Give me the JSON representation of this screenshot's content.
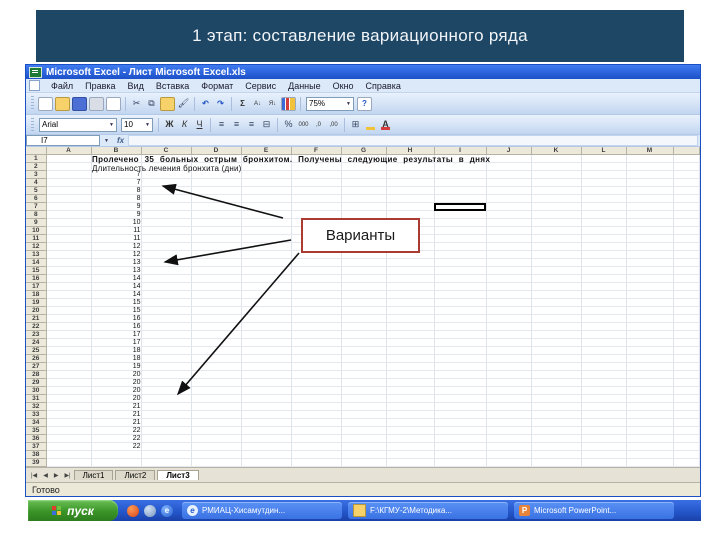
{
  "slide": {
    "title": "1 этап: составление вариационного  ряда"
  },
  "excel": {
    "window_title": "Microsoft Excel - Лист Microsoft Excel.xls",
    "menu_items": [
      "Файл",
      "Правка",
      "Вид",
      "Вставка",
      "Формат",
      "Сервис",
      "Данные",
      "Окно",
      "Справка"
    ],
    "zoom_level": "75%",
    "font_name": "Arial",
    "font_size": "10",
    "format_buttons": [
      "Ж",
      "К",
      "Ч"
    ],
    "name_box": "I7",
    "fx_label": "fx",
    "columns": [
      "A",
      "B",
      "C",
      "D",
      "E",
      "F",
      "G",
      "H",
      "I",
      "J",
      "K",
      "L",
      "M"
    ],
    "selected_column": "I",
    "selected_row": 7,
    "row1_text": "Пролечено 35 больных острым бронхитом. Получены следующие результаты в днях",
    "row2_text": "Длительность лечения бронхита (дни)",
    "values_start_row": 3,
    "values": [
      7,
      7,
      8,
      8,
      9,
      9,
      10,
      11,
      11,
      12,
      12,
      13,
      13,
      14,
      14,
      14,
      15,
      15,
      16,
      16,
      17,
      17,
      18,
      18,
      19,
      20,
      20,
      20,
      20,
      21,
      21,
      21,
      22,
      22,
      22
    ],
    "total_rows": 39,
    "sheet_tabs": [
      "Лист1",
      "Лист2",
      "Лист3"
    ],
    "status": "Готово"
  },
  "annotation": {
    "label": "Варианты"
  },
  "taskbar": {
    "start_label": "пуск",
    "buttons": [
      "РМИАЦ-Хисамутдин...",
      "F:\\КГМУ-2\\Методика...",
      "Microsoft PowerPoint..."
    ]
  }
}
